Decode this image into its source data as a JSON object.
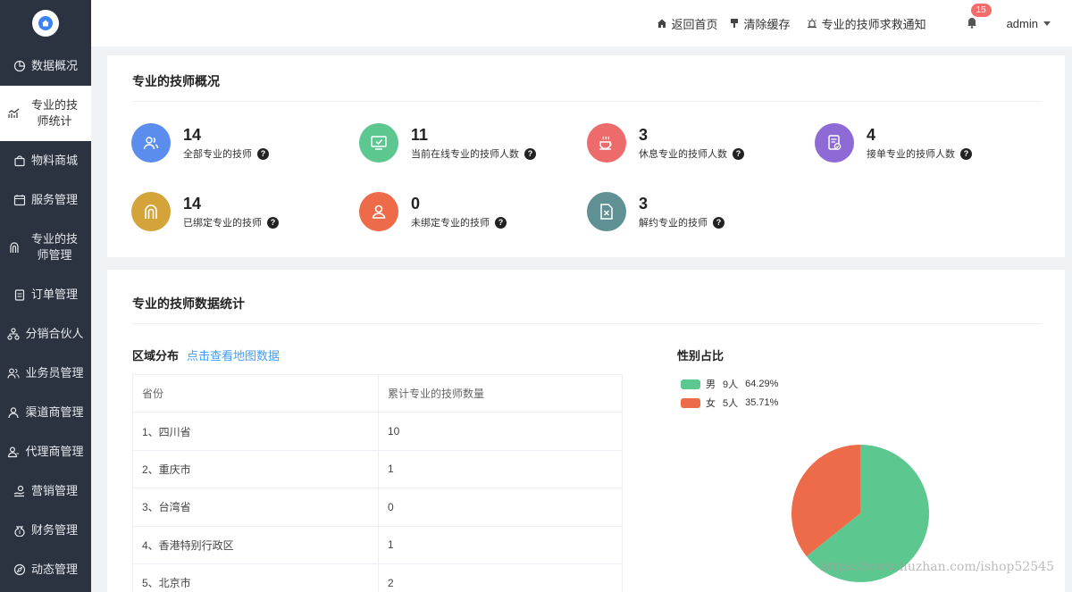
{
  "sidebar": {
    "items": [
      {
        "label": "数据概况",
        "icon": "pie-chart-icon"
      },
      {
        "label": "专业的技师统计",
        "icon": "line-chart-icon",
        "active": true
      },
      {
        "label": "物料商城",
        "icon": "shopping-bag-icon"
      },
      {
        "label": "服务管理",
        "icon": "calendar-icon"
      },
      {
        "label": "专业的技师管理",
        "icon": "user-arch-icon"
      },
      {
        "label": "订单管理",
        "icon": "clipboard-icon"
      },
      {
        "label": "分销合伙人",
        "icon": "network-icon"
      },
      {
        "label": "业务员管理",
        "icon": "users-icon"
      },
      {
        "label": "渠道商管理",
        "icon": "user-icon"
      },
      {
        "label": "代理商管理",
        "icon": "user-group-icon"
      },
      {
        "label": "营销管理",
        "icon": "hand-coin-icon"
      },
      {
        "label": "财务管理",
        "icon": "money-bag-icon"
      },
      {
        "label": "动态管理",
        "icon": "compass-icon"
      }
    ]
  },
  "header": {
    "home": "返回首页",
    "clear_cache": "清除缓存",
    "rescue": "专业的技师求救通知",
    "notify_count": "15",
    "user": "admin"
  },
  "overview": {
    "title": "专业的技师概况",
    "stats": [
      {
        "value": "14",
        "label": "全部专业的技师",
        "color": "#5b8def",
        "icon": "people-icon"
      },
      {
        "value": "11",
        "label": "当前在线专业的技师人数",
        "color": "#5cc78e",
        "icon": "monitor-check-icon"
      },
      {
        "value": "3",
        "label": "休息专业的技师人数",
        "color": "#ee6b6b",
        "icon": "coffee-icon"
      },
      {
        "value": "4",
        "label": "接单专业的技师人数",
        "color": "#8e6ad6",
        "icon": "document-check-icon"
      },
      {
        "value": "14",
        "label": "已绑定专业的技师",
        "color": "#d4a33a",
        "icon": "arch-icon"
      },
      {
        "value": "0",
        "label": "未绑定专业的技师",
        "color": "#ee6b4a",
        "icon": "person-icon"
      },
      {
        "value": "3",
        "label": "解约专业的技师",
        "color": "#5f9194",
        "icon": "file-x-icon"
      }
    ]
  },
  "stats_section": {
    "title": "专业的技师数据统计",
    "region_title": "区域分布",
    "map_link": "点击查看地图数据",
    "table": {
      "headers": [
        "省份",
        "累计专业的技师数量"
      ],
      "rows": [
        [
          "1、四川省",
          "10"
        ],
        [
          "2、重庆市",
          "1"
        ],
        [
          "3、台湾省",
          "0"
        ],
        [
          "4、香港特别行政区",
          "1"
        ],
        [
          "5、北京市",
          "2"
        ]
      ]
    },
    "gender_title": "性别占比"
  },
  "chart_data": {
    "type": "pie",
    "title": "性别占比",
    "categories": [
      "男",
      "女"
    ],
    "values": [
      9,
      5
    ],
    "percent_labels": [
      "64.29%",
      "35.71%"
    ],
    "count_labels": [
      "9人",
      "5人"
    ],
    "colors": [
      "#5cc78e",
      "#ee6b4a"
    ],
    "legend": "top-left"
  },
  "watermark": "https://www.huzhan.com/ishop52545"
}
